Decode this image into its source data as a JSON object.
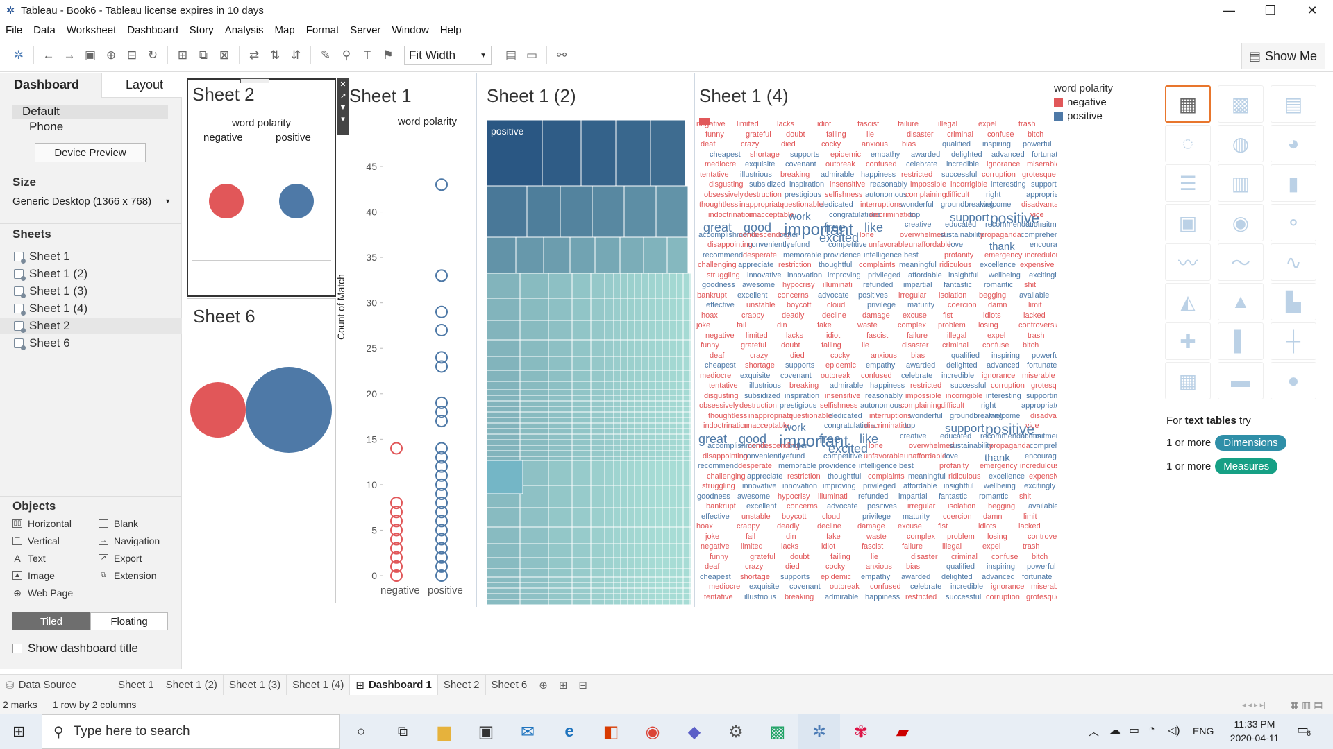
{
  "window": {
    "title": "Tableau - Book6 - Tableau license expires in 10 days",
    "minimize": "—",
    "restore": "❐",
    "close": "✕"
  },
  "menu": [
    "File",
    "Data",
    "Worksheet",
    "Dashboard",
    "Story",
    "Analysis",
    "Map",
    "Format",
    "Server",
    "Window",
    "Help"
  ],
  "toolbar": {
    "fit_label": "Fit Width",
    "show_me": "Show Me"
  },
  "left_panel": {
    "tab_dashboard": "Dashboard",
    "tab_layout": "Layout",
    "device_default": "Default",
    "device_phone": "Phone",
    "device_preview": "Device Preview",
    "size_heading": "Size",
    "size_value": "Generic Desktop (1366 x 768)",
    "sheets_heading": "Sheets",
    "sheets": [
      "Sheet 1",
      "Sheet 1 (2)",
      "Sheet 1 (3)",
      "Sheet 1 (4)",
      "Sheet 2",
      "Sheet 6"
    ],
    "objects_heading": "Objects",
    "objects": [
      {
        "label": "Horizontal",
        "icon": "horizontal-icon"
      },
      {
        "label": "Blank",
        "icon": "blank-icon"
      },
      {
        "label": "Vertical",
        "icon": "vertical-icon"
      },
      {
        "label": "Navigation",
        "icon": "navigation-icon"
      },
      {
        "label": "Text",
        "icon": "text-icon"
      },
      {
        "label": "Export",
        "icon": "export-icon"
      },
      {
        "label": "Image",
        "icon": "image-icon"
      },
      {
        "label": "Extension",
        "icon": "extension-icon"
      },
      {
        "label": "Web Page",
        "icon": "web-page-icon"
      }
    ],
    "tiled": "Tiled",
    "floating": "Floating",
    "show_title": "Show dashboard title"
  },
  "dashboard": {
    "sheet2": {
      "title": "Sheet 2",
      "header": "word polarity",
      "cols": [
        "negative",
        "positive"
      ]
    },
    "sheet6": {
      "title": "Sheet 6"
    },
    "sheet1": {
      "title": "Sheet 1",
      "header": "word polarity",
      "ylabel": "Count of Match",
      "yticks": [
        "45",
        "40",
        "35",
        "30",
        "25",
        "20",
        "15",
        "10",
        "5",
        "0"
      ],
      "cols": [
        "negative",
        "positive"
      ]
    },
    "sheet12": {
      "title": "Sheet 1 (2)",
      "label": "positive"
    },
    "sheet14": {
      "title": "Sheet 1 (4)"
    },
    "legend": {
      "title": "word polarity",
      "items": [
        "negative",
        "positive"
      ]
    }
  },
  "colors": {
    "negative": "#e15759",
    "positive": "#4e79a7",
    "teal_dark": "#2a5783",
    "teal_light": "#a7dcd5",
    "orange_accent": "#e8762d",
    "dim_pill": "#2f8fa8",
    "meas_pill": "#16a085"
  },
  "chart_data": {
    "type": "scatter",
    "title": "Sheet 1",
    "xlabel": "",
    "ylabel": "Count of Match",
    "categories": [
      "negative",
      "positive"
    ],
    "ylim": [
      0,
      45
    ],
    "series": [
      {
        "name": "negative",
        "values": [
          14,
          8,
          7,
          6,
          5,
          4,
          3,
          2,
          1,
          0
        ]
      },
      {
        "name": "positive",
        "values": [
          43,
          33,
          29,
          27,
          24,
          23,
          19,
          18,
          17,
          14,
          13,
          12,
          11,
          10,
          9,
          8,
          7,
          6,
          5,
          4,
          3,
          2,
          1,
          0
        ]
      }
    ]
  },
  "wordcloud": [
    [
      "negative",
      "negative"
    ],
    [
      "limited",
      "negative"
    ],
    [
      "lacks",
      "negative"
    ],
    [
      "idiot",
      "negative"
    ],
    [
      "fascist",
      "negative"
    ],
    [
      "failure",
      "negative"
    ],
    [
      "illegal",
      "negative"
    ],
    [
      "expel",
      "negative"
    ],
    [
      "trash",
      "negative"
    ],
    [
      "funny",
      "negative"
    ],
    [
      "grateful",
      "negative"
    ],
    [
      "doubt",
      "negative"
    ],
    [
      "failing",
      "negative"
    ],
    [
      "lie",
      "negative"
    ],
    [
      "disaster",
      "negative"
    ],
    [
      "criminal",
      "negative"
    ],
    [
      "confuse",
      "negative"
    ],
    [
      "bitch",
      "negative"
    ],
    [
      "deaf",
      "negative"
    ],
    [
      "crazy",
      "negative"
    ],
    [
      "died",
      "negative"
    ],
    [
      "cocky",
      "negative"
    ],
    [
      "anxious",
      "negative"
    ],
    [
      "bias",
      "negative"
    ],
    [
      "qualified",
      "positive"
    ],
    [
      "inspiring",
      "positive"
    ],
    [
      "powerful",
      "positive"
    ],
    [
      "cheapest",
      "positive"
    ],
    [
      "shortage",
      "negative"
    ],
    [
      "supports",
      "positive"
    ],
    [
      "epidemic",
      "negative"
    ],
    [
      "empathy",
      "positive"
    ],
    [
      "awarded",
      "positive"
    ],
    [
      "delighted",
      "positive"
    ],
    [
      "advanced",
      "positive"
    ],
    [
      "fortunate",
      "positive"
    ],
    [
      "mediocre",
      "negative"
    ],
    [
      "exquisite",
      "positive"
    ],
    [
      "covenant",
      "positive"
    ],
    [
      "outbreak",
      "negative"
    ],
    [
      "confused",
      "negative"
    ],
    [
      "celebrate",
      "positive"
    ],
    [
      "incredible",
      "positive"
    ],
    [
      "ignorance",
      "negative"
    ],
    [
      "miserable",
      "negative"
    ],
    [
      "tentative",
      "negative"
    ],
    [
      "illustrious",
      "positive"
    ],
    [
      "breaking",
      "negative"
    ],
    [
      "admirable",
      "positive"
    ],
    [
      "happiness",
      "positive"
    ],
    [
      "restricted",
      "negative"
    ],
    [
      "successful",
      "positive"
    ],
    [
      "corruption",
      "negative"
    ],
    [
      "grotesque",
      "negative"
    ],
    [
      "disgusting",
      "negative"
    ],
    [
      "subsidized",
      "positive"
    ],
    [
      "inspiration",
      "positive"
    ],
    [
      "insensitive",
      "negative"
    ],
    [
      "reasonably",
      "positive"
    ],
    [
      "impossible",
      "negative"
    ],
    [
      "incorrigible",
      "negative"
    ],
    [
      "interesting",
      "positive"
    ],
    [
      "supporting",
      "positive"
    ],
    [
      "obsessively",
      "negative"
    ],
    [
      "destruction",
      "negative"
    ],
    [
      "prestigious",
      "positive"
    ],
    [
      "selfishness",
      "negative"
    ],
    [
      "autonomous",
      "positive"
    ],
    [
      "complaining",
      "negative"
    ],
    [
      "difficult",
      "negative"
    ],
    [
      "right",
      "positive"
    ],
    [
      "appropriate",
      "positive"
    ],
    [
      "thoughtless",
      "negative"
    ],
    [
      "inappropriate",
      "negative"
    ],
    [
      "questionable",
      "negative"
    ],
    [
      "dedicated",
      "positive"
    ],
    [
      "interruptions",
      "negative"
    ],
    [
      "wonderful",
      "positive"
    ],
    [
      "groundbreaking",
      "positive"
    ],
    [
      "welcome",
      "positive"
    ],
    [
      "disadvantage",
      "negative"
    ],
    [
      "indoctrination",
      "negative"
    ],
    [
      "unacceptable",
      "negative"
    ],
    [
      "work",
      "positive"
    ],
    [
      "congratulations",
      "positive"
    ],
    [
      "discrimination",
      "negative"
    ],
    [
      "top",
      "positive"
    ],
    [
      "support",
      "positive"
    ],
    [
      "positive",
      "positive"
    ],
    [
      "vice",
      "negative"
    ],
    [
      "great",
      "positive"
    ],
    [
      "good",
      "positive"
    ],
    [
      "important",
      "positive"
    ],
    [
      "free",
      "positive"
    ],
    [
      "like",
      "positive"
    ],
    [
      "creative",
      "positive"
    ],
    [
      "educated",
      "positive"
    ],
    [
      "recommendations",
      "positive"
    ],
    [
      "commitment",
      "positive"
    ],
    [
      "accomplishments",
      "positive"
    ],
    [
      "condescending",
      "negative"
    ],
    [
      "better",
      "positive"
    ],
    [
      "excited",
      "positive"
    ],
    [
      "lone",
      "negative"
    ],
    [
      "overwhelmed",
      "negative"
    ],
    [
      "sustainability",
      "positive"
    ],
    [
      "propaganda",
      "negative"
    ],
    [
      "comprehensive",
      "positive"
    ],
    [
      "disappointing",
      "negative"
    ],
    [
      "conveniently",
      "positive"
    ],
    [
      "refund",
      "positive"
    ],
    [
      "competitive",
      "positive"
    ],
    [
      "unfavorable",
      "negative"
    ],
    [
      "unaffordable",
      "negative"
    ],
    [
      "love",
      "positive"
    ],
    [
      "thank",
      "positive"
    ],
    [
      "encouraging",
      "positive"
    ],
    [
      "recommend",
      "positive"
    ],
    [
      "desperate",
      "negative"
    ],
    [
      "memorable",
      "positive"
    ],
    [
      "providence",
      "positive"
    ],
    [
      "intelligence",
      "positive"
    ],
    [
      "best",
      "positive"
    ],
    [
      "profanity",
      "negative"
    ],
    [
      "emergency",
      "negative"
    ],
    [
      "incredulous",
      "negative"
    ],
    [
      "challenging",
      "negative"
    ],
    [
      "appreciate",
      "positive"
    ],
    [
      "restriction",
      "negative"
    ],
    [
      "thoughtful",
      "positive"
    ],
    [
      "complaints",
      "negative"
    ],
    [
      "meaningful",
      "positive"
    ],
    [
      "ridiculous",
      "negative"
    ],
    [
      "excellence",
      "positive"
    ],
    [
      "expensive",
      "negative"
    ],
    [
      "struggling",
      "negative"
    ],
    [
      "innovative",
      "positive"
    ],
    [
      "innovation",
      "positive"
    ],
    [
      "improving",
      "positive"
    ],
    [
      "privileged",
      "positive"
    ],
    [
      "affordable",
      "positive"
    ],
    [
      "insightful",
      "positive"
    ],
    [
      "wellbeing",
      "positive"
    ],
    [
      "excitingly",
      "positive"
    ],
    [
      "goodness",
      "positive"
    ],
    [
      "awesome",
      "positive"
    ],
    [
      "hypocrisy",
      "negative"
    ],
    [
      "illuminati",
      "negative"
    ],
    [
      "refunded",
      "positive"
    ],
    [
      "impartial",
      "positive"
    ],
    [
      "fantastic",
      "positive"
    ],
    [
      "romantic",
      "positive"
    ],
    [
      "shit",
      "negative"
    ],
    [
      "bankrupt",
      "negative"
    ],
    [
      "excellent",
      "positive"
    ],
    [
      "concerns",
      "negative"
    ],
    [
      "advocate",
      "positive"
    ],
    [
      "positives",
      "positive"
    ],
    [
      "irregular",
      "negative"
    ],
    [
      "isolation",
      "negative"
    ],
    [
      "begging",
      "negative"
    ],
    [
      "available",
      "positive"
    ],
    [
      "effective",
      "positive"
    ],
    [
      "unstable",
      "negative"
    ],
    [
      "boycott",
      "negative"
    ],
    [
      "cloud",
      "negative"
    ],
    [
      "privilege",
      "positive"
    ],
    [
      "maturity",
      "positive"
    ],
    [
      "coercion",
      "negative"
    ],
    [
      "damn",
      "negative"
    ],
    [
      "limit",
      "negative"
    ],
    [
      "hoax",
      "negative"
    ],
    [
      "crappy",
      "negative"
    ],
    [
      "deadly",
      "negative"
    ],
    [
      "decline",
      "negative"
    ],
    [
      "damage",
      "negative"
    ],
    [
      "excuse",
      "negative"
    ],
    [
      "fist",
      "negative"
    ],
    [
      "idiots",
      "negative"
    ],
    [
      "lacked",
      "negative"
    ],
    [
      "joke",
      "negative"
    ],
    [
      "fail",
      "negative"
    ],
    [
      "din",
      "negative"
    ],
    [
      "fake",
      "negative"
    ],
    [
      "waste",
      "negative"
    ],
    [
      "complex",
      "negative"
    ],
    [
      "problem",
      "negative"
    ],
    [
      "losing",
      "negative"
    ],
    [
      "controversial",
      "negative"
    ]
  ],
  "showme": {
    "hint_prefix": "For ",
    "hint_bold": "text tables",
    "hint_suffix": " try",
    "row1_prefix": "1 or more",
    "row1_pill": "Dimensions",
    "row2_prefix": "1 or more",
    "row2_pill": "Measures"
  },
  "tabs": [
    "Data Source",
    "Sheet 1",
    "Sheet 1 (2)",
    "Sheet 1 (3)",
    "Sheet 1 (4)",
    "Dashboard 1",
    "Sheet 2",
    "Sheet 6"
  ],
  "status": {
    "marks": "2 marks",
    "dims": "1 row by 2 columns"
  },
  "taskbar": {
    "search_placeholder": "Type here to search",
    "time": "11:33 PM",
    "date": "2020-04-11",
    "lang": "ENG",
    "notif_count": "6"
  }
}
